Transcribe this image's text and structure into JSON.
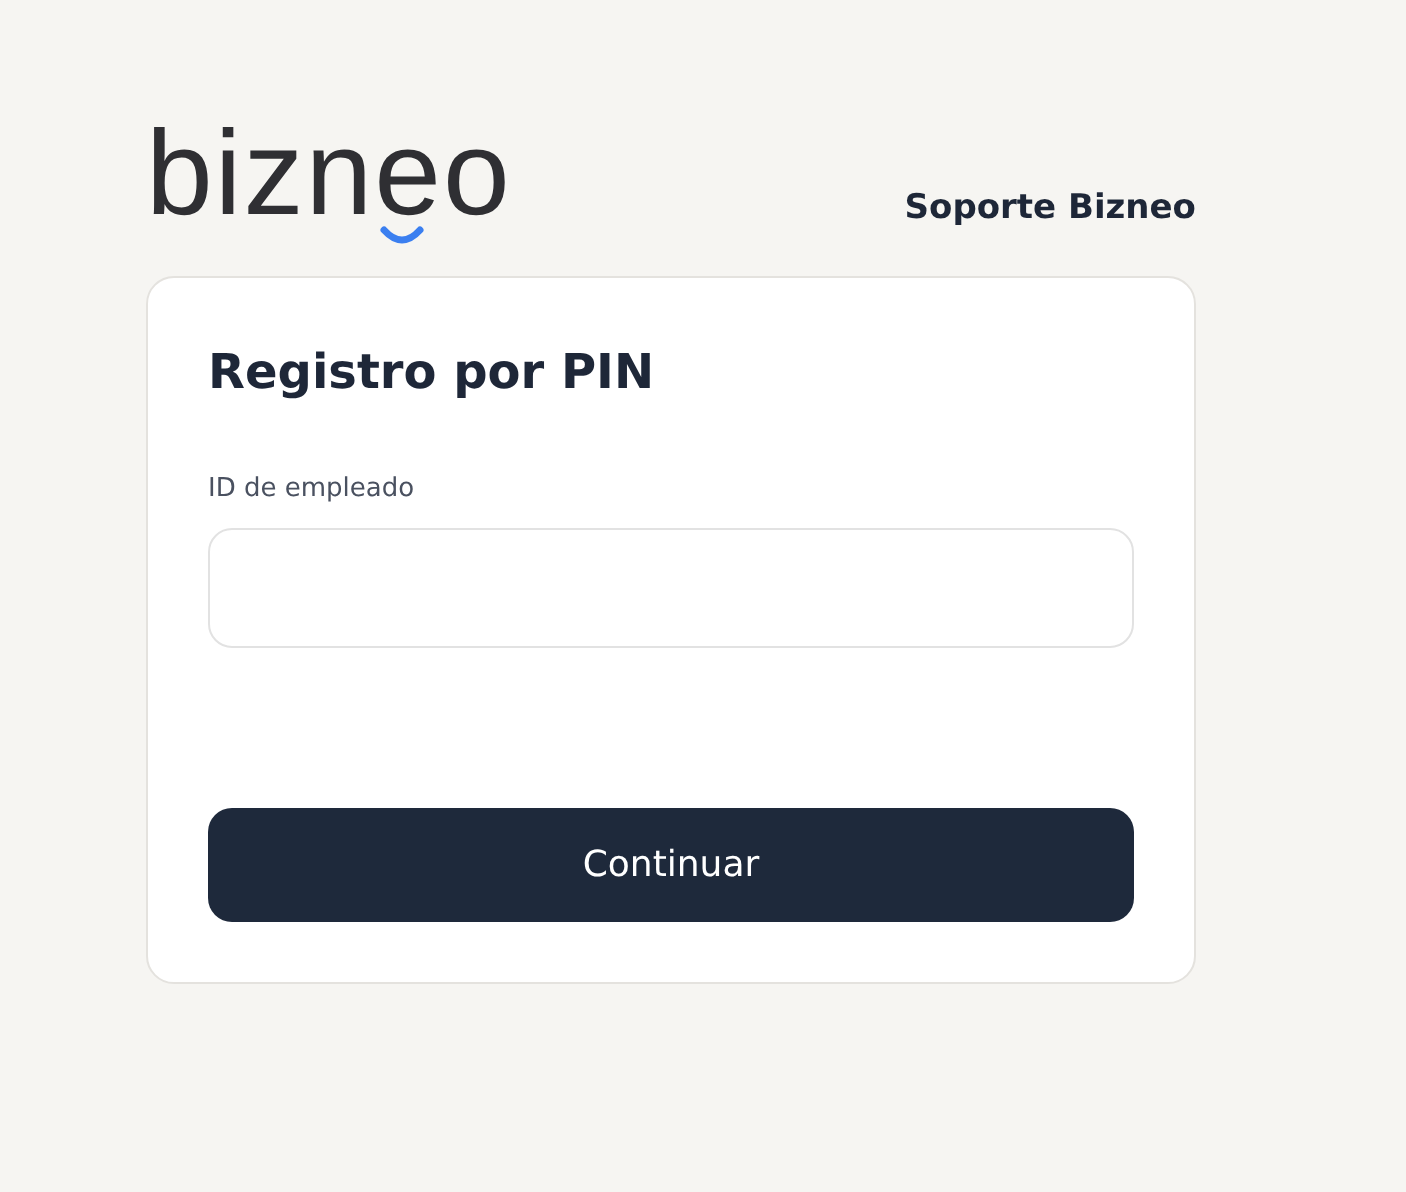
{
  "logo": {
    "text": "bizneo"
  },
  "header": {
    "support_link": "Soporte Bizneo"
  },
  "card": {
    "title": "Registro por PIN",
    "field": {
      "label": "ID de empleado"
    },
    "button": "Continuar"
  }
}
